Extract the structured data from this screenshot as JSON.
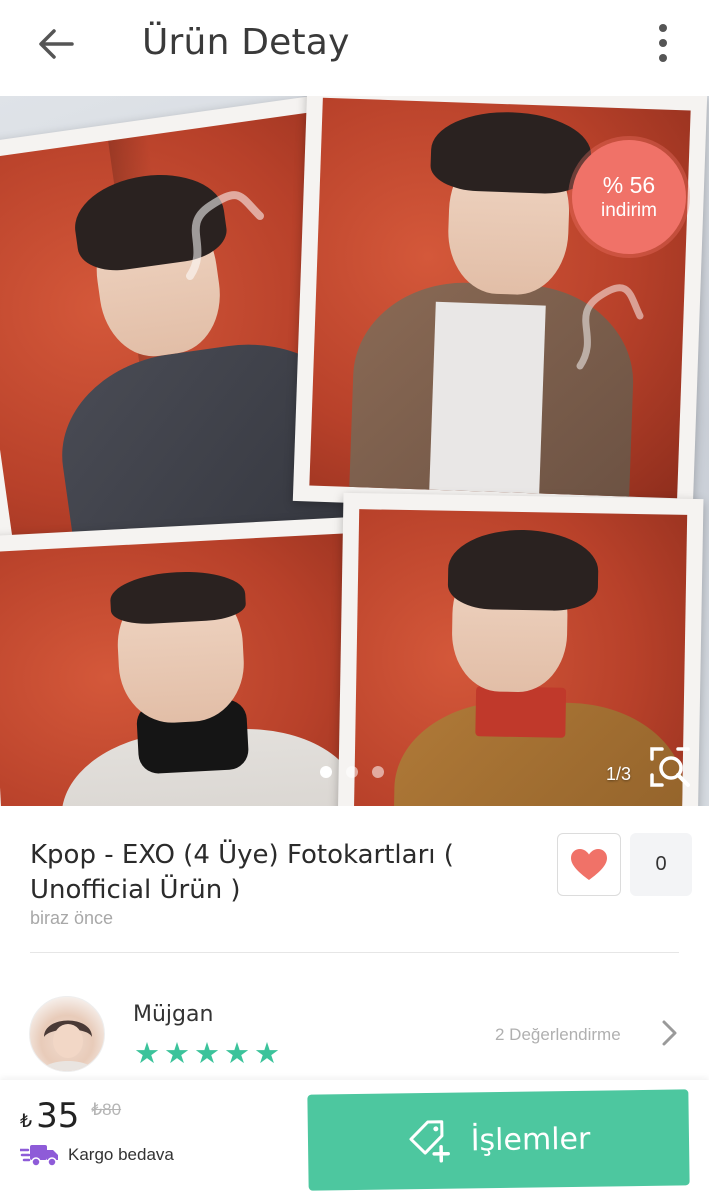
{
  "header": {
    "title": "Ürün Detay",
    "back_icon": "arrow-left-icon",
    "more_icon": "more-vertical-icon"
  },
  "gallery": {
    "counter": "1/3",
    "current_index": 1,
    "total": 3,
    "zoom_icon": "zoom-search-icon"
  },
  "discount_badge": {
    "percent": "% 56",
    "label": "indirim",
    "color": "#f07268"
  },
  "product": {
    "title": "Kpop - EXO (4 Üye) Fotokartları ( Unofficial Ürün )",
    "posted": "biraz önce",
    "favorite_icon": "heart-icon",
    "favorite_count": "0"
  },
  "seller": {
    "name": "Müjgan",
    "rating_stars": 5,
    "reviews": "2 Değerlendirme",
    "star_color": "#3cc39b"
  },
  "purchase": {
    "currency": "₺",
    "price": "35",
    "old_price": "₺80",
    "shipping": "Kargo bedava",
    "shipping_icon": "truck-icon",
    "actions_label": "İşlemler",
    "actions_icon": "tag-add-icon",
    "accent": "#4dc79f"
  }
}
